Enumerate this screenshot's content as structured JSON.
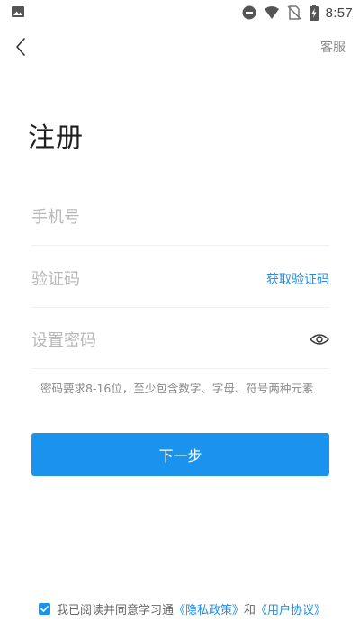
{
  "status_bar": {
    "time": "8:57",
    "icons": [
      "image-icon",
      "dnd-icon",
      "wifi-icon",
      "no-sim-icon",
      "battery-charging-icon"
    ]
  },
  "nav": {
    "back_icon": "chevron-left-icon",
    "customer_service": "客服"
  },
  "page_title": "注册",
  "form": {
    "phone_placeholder": "手机号",
    "code_placeholder": "验证码",
    "get_code_label": "获取验证码",
    "password_placeholder": "设置密码",
    "password_visibility_icon": "eye-icon",
    "password_hint": "密码要求8-16位，至少包含数字、字母、符号两种元素"
  },
  "next_button": "下一步",
  "agreement": {
    "checked": true,
    "prefix": "我已阅读并同意学习通",
    "privacy_link": "《隐私政策》",
    "and": "和",
    "user_agreement_link": "《用户协议》"
  },
  "colors": {
    "accent": "#1a93ee",
    "link": "#1f8ceb",
    "placeholder": "#b8b8b8",
    "hint": "#8b8b8b"
  }
}
